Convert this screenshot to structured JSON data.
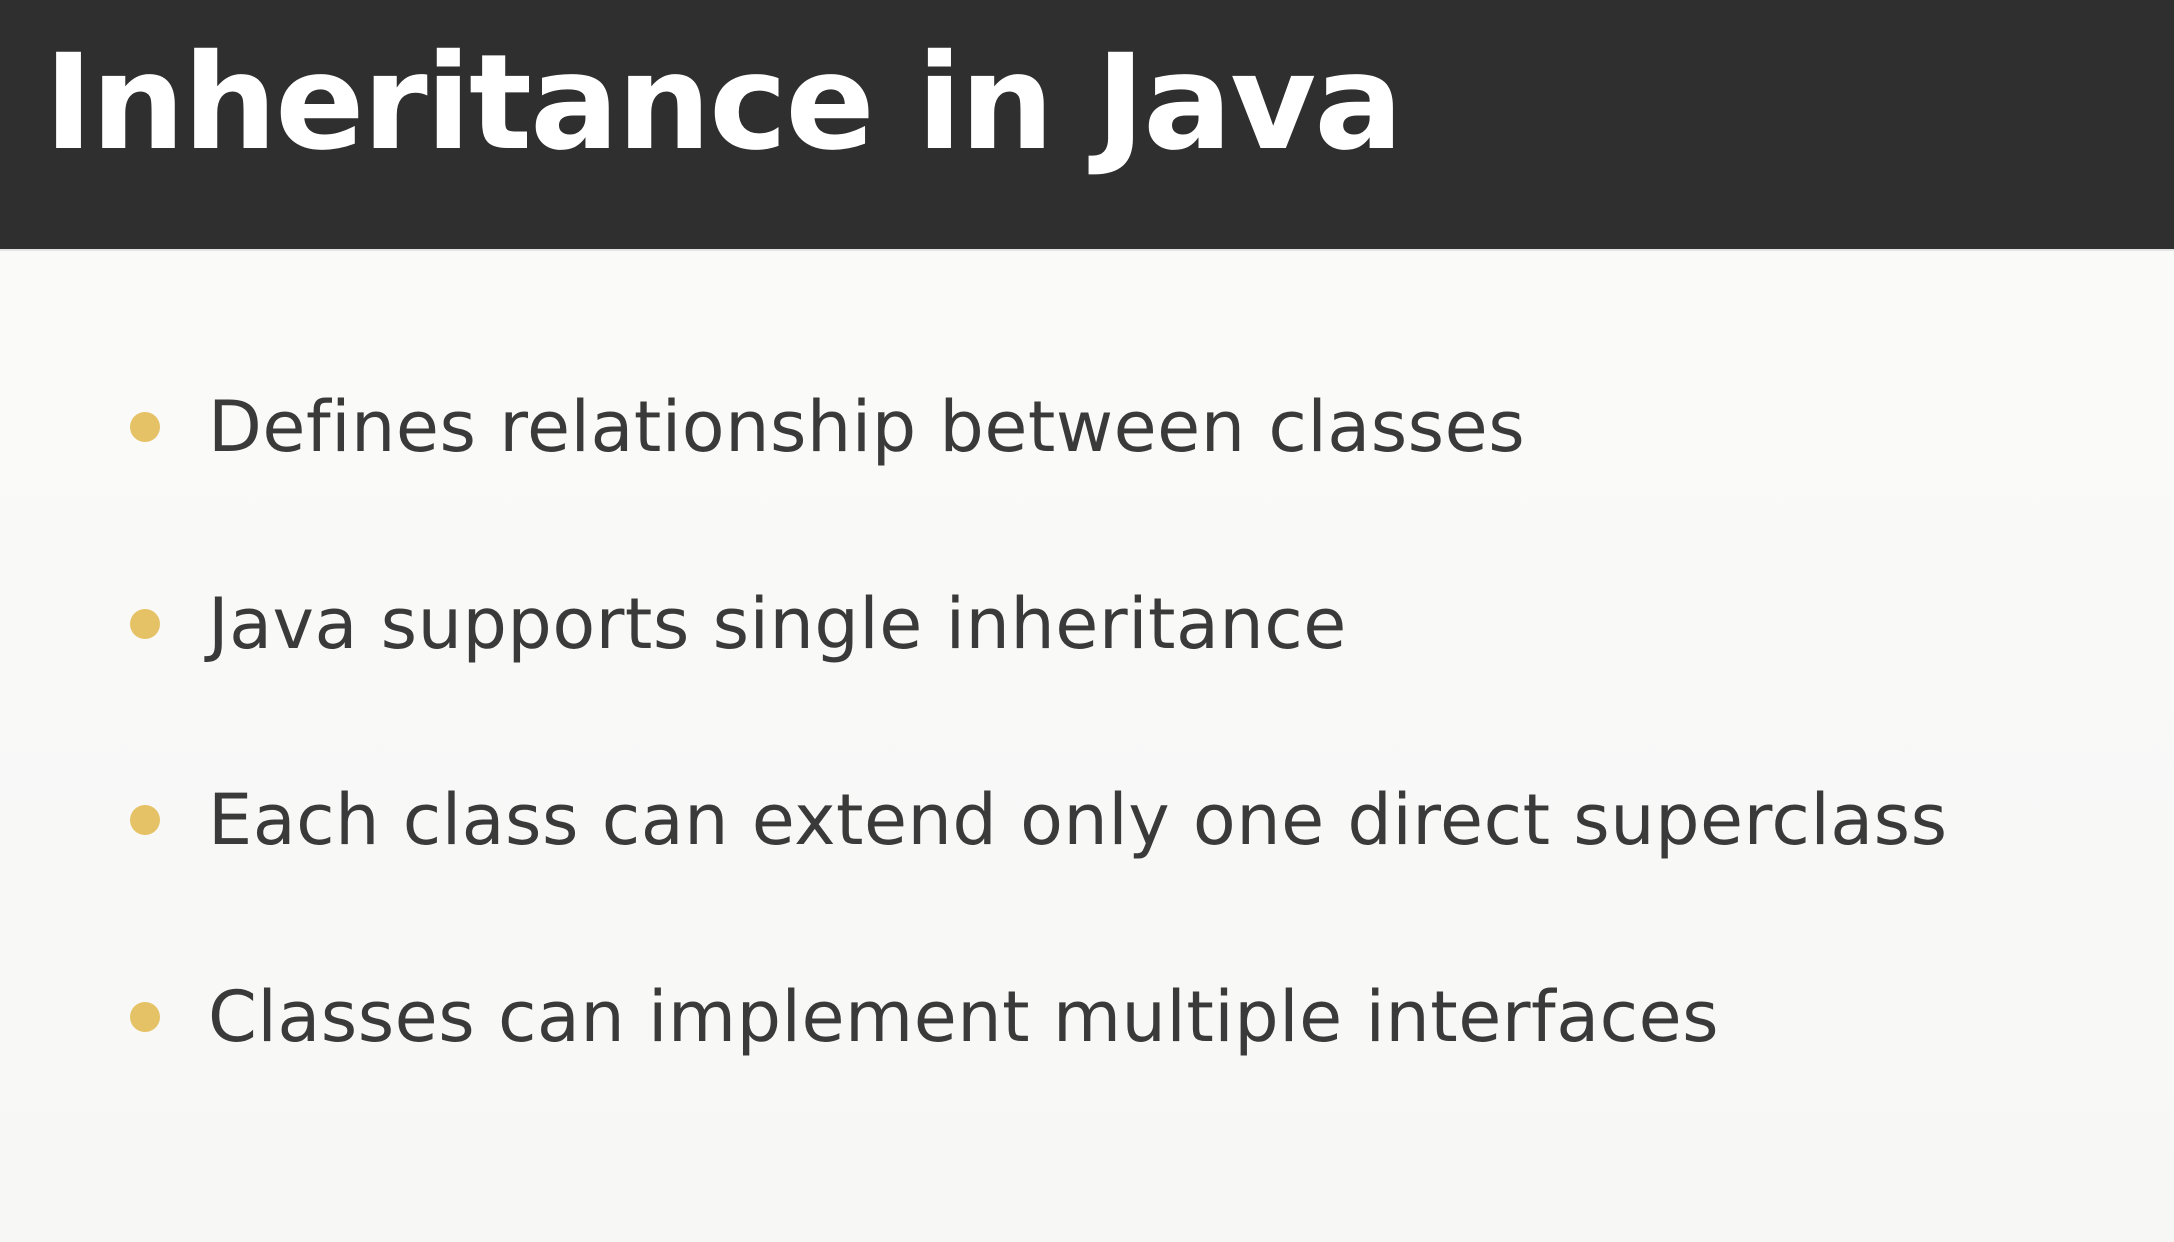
{
  "slide": {
    "title": "Inheritance in Java",
    "bullets": [
      "Defines relationship between classes",
      "Java supports single inheritance",
      "Each class can extend only one direct superclass",
      "Classes can implement multiple interfaces"
    ]
  },
  "colors": {
    "title_bar": "#2f2f2f",
    "title_text": "#ffffff",
    "bullet_dot": "#e6c266",
    "body_text": "#3a3a3a",
    "background": "#fafaf9"
  },
  "icons": {
    "bullet": "bullet-dot-icon"
  }
}
